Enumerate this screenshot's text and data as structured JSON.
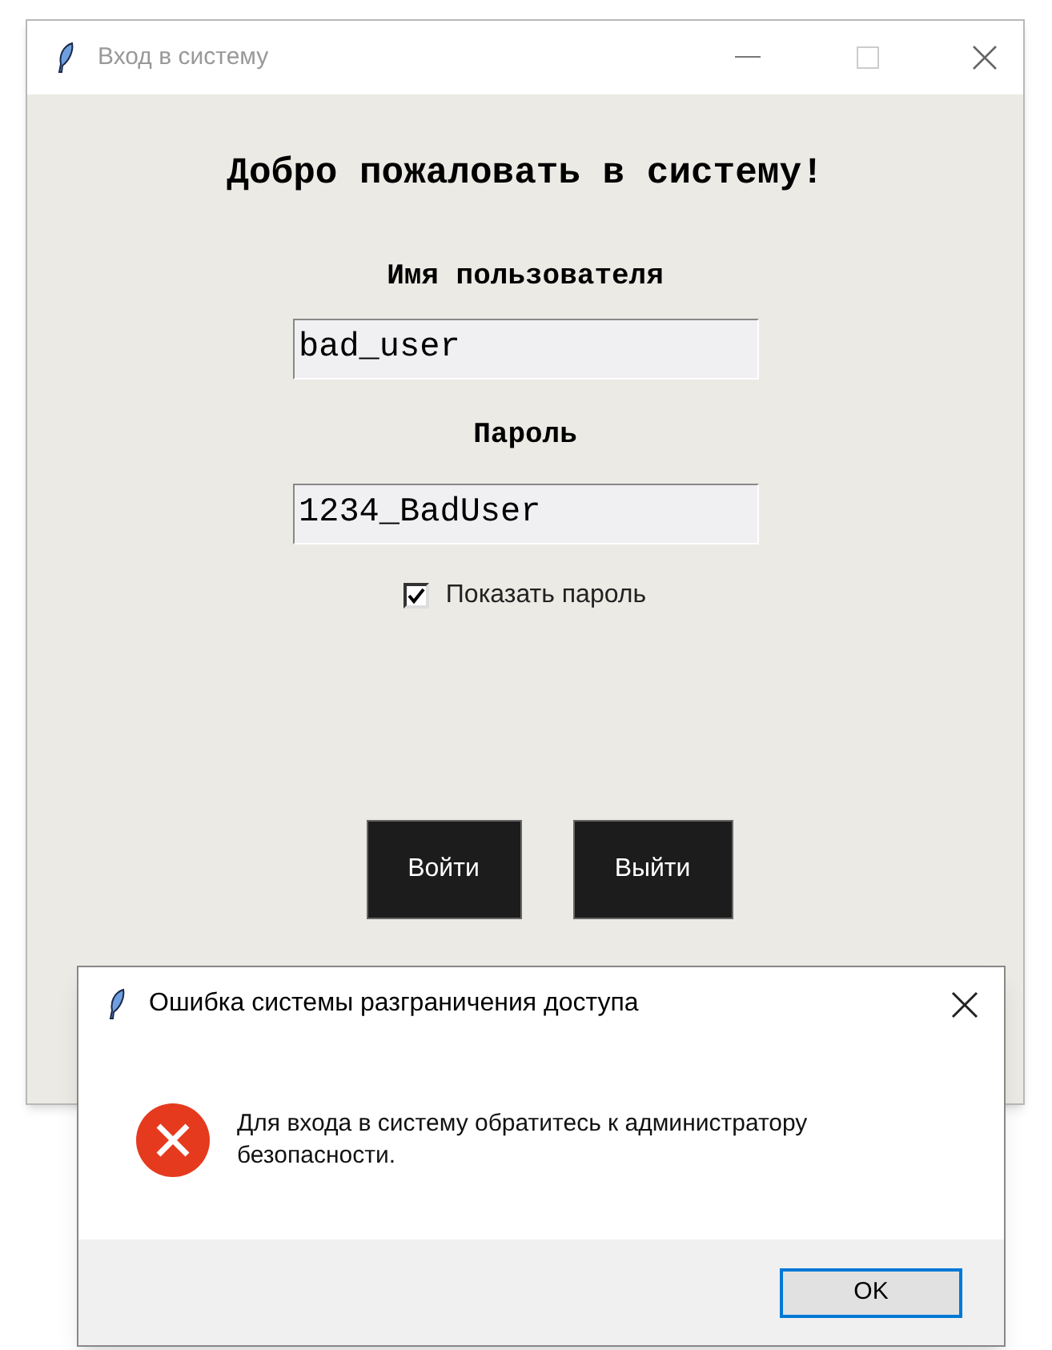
{
  "window": {
    "title": "Вход в систему"
  },
  "heading": "Добро пожаловать в систему!",
  "username": {
    "label": "Имя пользователя",
    "value": "bad_user"
  },
  "password": {
    "label": "Пароль",
    "value": "1234_BadUser"
  },
  "show_password": {
    "label": "Показать пароль",
    "checked": true
  },
  "buttons": [
    "Войти",
    "Выйти"
  ],
  "dialog": {
    "title": "Ошибка системы разграничения доступа",
    "message": "Для входа в систему обратитесь к администратору безопасности.",
    "button": "OK"
  }
}
